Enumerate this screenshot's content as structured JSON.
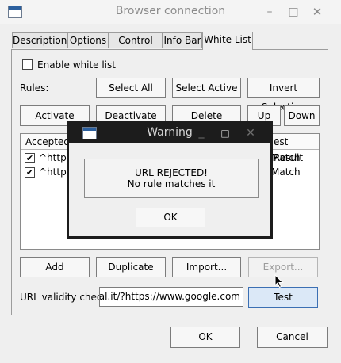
{
  "window": {
    "title": "Browser connection",
    "minimize": "–",
    "maximize": "□",
    "close": "✕"
  },
  "tabs": [
    {
      "label": "Description"
    },
    {
      "label": "Options"
    },
    {
      "label": "Control Bar"
    },
    {
      "label": "Info Bar"
    },
    {
      "label": "White List"
    }
  ],
  "active_tab": "White List",
  "enable_whitelist": {
    "label": "Enable white list",
    "checked": false
  },
  "rules_label": "Rules:",
  "buttons": {
    "select_all": "Select All",
    "select_active": "Select Active",
    "invert_selection": "Invert Selection",
    "activate": "Activate",
    "deactivate": "Deactivate",
    "delete": "Delete",
    "up": "Up",
    "down": "Down",
    "add": "Add",
    "duplicate": "Duplicate",
    "import": "Import...",
    "export": "Export...",
    "test": "Test",
    "ok": "OK",
    "cancel": "Cancel"
  },
  "table": {
    "columns": [
      "Accepted",
      "est Result"
    ],
    "rows": [
      {
        "checked": true,
        "rule": "^https",
        "result": "Match"
      },
      {
        "checked": true,
        "rule": "^https",
        "result": "Match"
      }
    ]
  },
  "url_check": {
    "label": "URL validity check",
    "value": "eal.it/?https://www.google.com"
  },
  "dialog": {
    "title": "Warning",
    "line1": "URL REJECTED!",
    "line2": "No rule matches it",
    "ok": "OK",
    "minimize": "_",
    "maximize": "□",
    "close": "✕"
  },
  "colors": {
    "dialog_frame": "#1c1c1c",
    "test_button": "#dbe8f7",
    "title_text": "#8c8c8c"
  }
}
